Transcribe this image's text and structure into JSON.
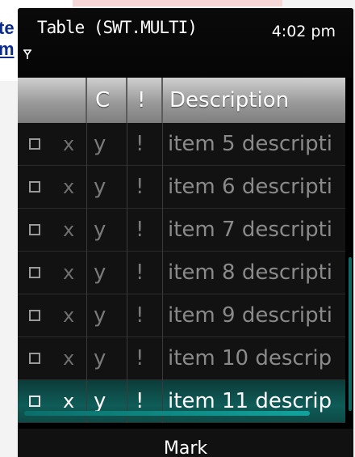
{
  "background_fragment": {
    "line1": "te",
    "line2": "m"
  },
  "status": {
    "title": "Table (SWT.MULTI)",
    "time": "4:02 pm"
  },
  "table": {
    "headers": [
      "",
      "C",
      "!",
      "Description"
    ],
    "rows": [
      {
        "x": "x",
        "c": "y",
        "bang": "!",
        "description": "item 5 descripti",
        "selected": false
      },
      {
        "x": "x",
        "c": "y",
        "bang": "!",
        "description": "item 6 descripti",
        "selected": false
      },
      {
        "x": "x",
        "c": "y",
        "bang": "!",
        "description": "item 7 descripti",
        "selected": false
      },
      {
        "x": "x",
        "c": "y",
        "bang": "!",
        "description": "item 8 descripti",
        "selected": false
      },
      {
        "x": "x",
        "c": "y",
        "bang": "!",
        "description": "item 9 descripti",
        "selected": false
      },
      {
        "x": "x",
        "c": "y",
        "bang": "!",
        "description": "item 10 descrip",
        "selected": false
      },
      {
        "x": "x",
        "c": "y",
        "bang": "!",
        "description": "item 11 descrip",
        "selected": true
      }
    ]
  },
  "softkeys": {
    "middle": "Mark"
  },
  "colors": {
    "accent": "#0f5c58"
  }
}
